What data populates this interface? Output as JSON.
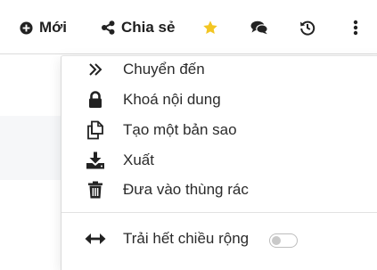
{
  "toolbar": {
    "new_label": "Mới",
    "share_label": "Chia sẻ",
    "icons": {
      "new": "plus-circle-icon",
      "share": "share-icon",
      "star": "star-icon",
      "chat": "comments-icon",
      "history": "history-icon",
      "more": "vertical-ellipsis-icon"
    },
    "star_color": "#f3c623"
  },
  "menu": {
    "items": [
      {
        "label": "Chuyển đến",
        "icon": "double-chevron-right-icon"
      },
      {
        "label": "Khoá nội dung",
        "icon": "lock-icon"
      },
      {
        "label": "Tạo một bản sao",
        "icon": "copy-icon"
      },
      {
        "label": "Xuất",
        "icon": "download-icon"
      },
      {
        "label": "Đưa vào thùng rác",
        "icon": "trash-icon"
      }
    ],
    "full_width": {
      "label": "Trải hết chiều rộng",
      "icon": "horizontal-arrows-icon",
      "enabled": false
    }
  }
}
